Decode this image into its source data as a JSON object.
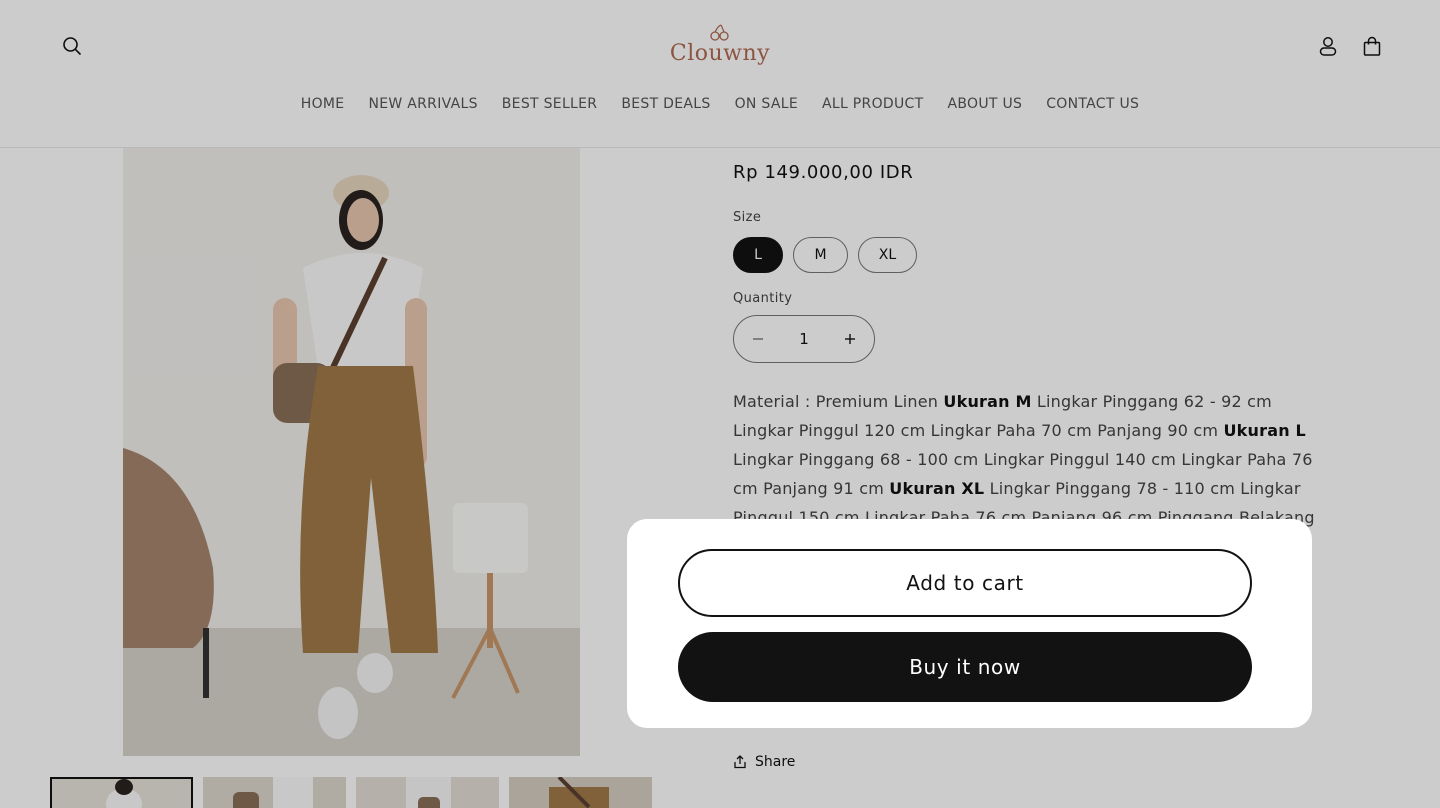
{
  "header": {
    "logo_text": "Clouwny",
    "nav": [
      "HOME",
      "NEW ARRIVALS",
      "BEST SELLER",
      "BEST DEALS",
      "ON SALE",
      "ALL PRODUCT",
      "ABOUT US",
      "CONTACT US"
    ]
  },
  "product": {
    "price": "Rp 149.000,00 IDR",
    "size_label": "Size",
    "sizes": [
      "L",
      "M",
      "XL"
    ],
    "selected_size": "L",
    "quantity_label": "Quantity",
    "quantity": "1",
    "description": [
      {
        "t": "Material : Premium Linen ",
        "b": false
      },
      {
        "t": "Ukuran M",
        "b": true
      },
      {
        "t": " Lingkar Pinggang 62 - 92 cm Lingkar Pinggul 120 cm Lingkar Paha 70 cm Panjang 90 cm ",
        "b": false
      },
      {
        "t": "Ukuran L",
        "b": true
      },
      {
        "t": " Lingkar Pinggang 68 - 100 cm Lingkar Pinggul 140 cm Lingkar Paha 76 cm Panjang 91 cm ",
        "b": false
      },
      {
        "t": "Ukuran XL",
        "b": true
      },
      {
        "t": " Lingkar Pinggang 78 - 110 cm Lingkar Pinggul 150 cm Lingkar Paha 76 cm Panjang 96 cm Pinggang Belakang Karet / Kiri Kanan",
        "b": false
      }
    ],
    "share_label": "Share"
  },
  "buy_panel": {
    "add_to_cart": "Add to cart",
    "buy_now": "Buy it now"
  },
  "colors": {
    "accent": "#121212",
    "logo": "#b06a52"
  }
}
